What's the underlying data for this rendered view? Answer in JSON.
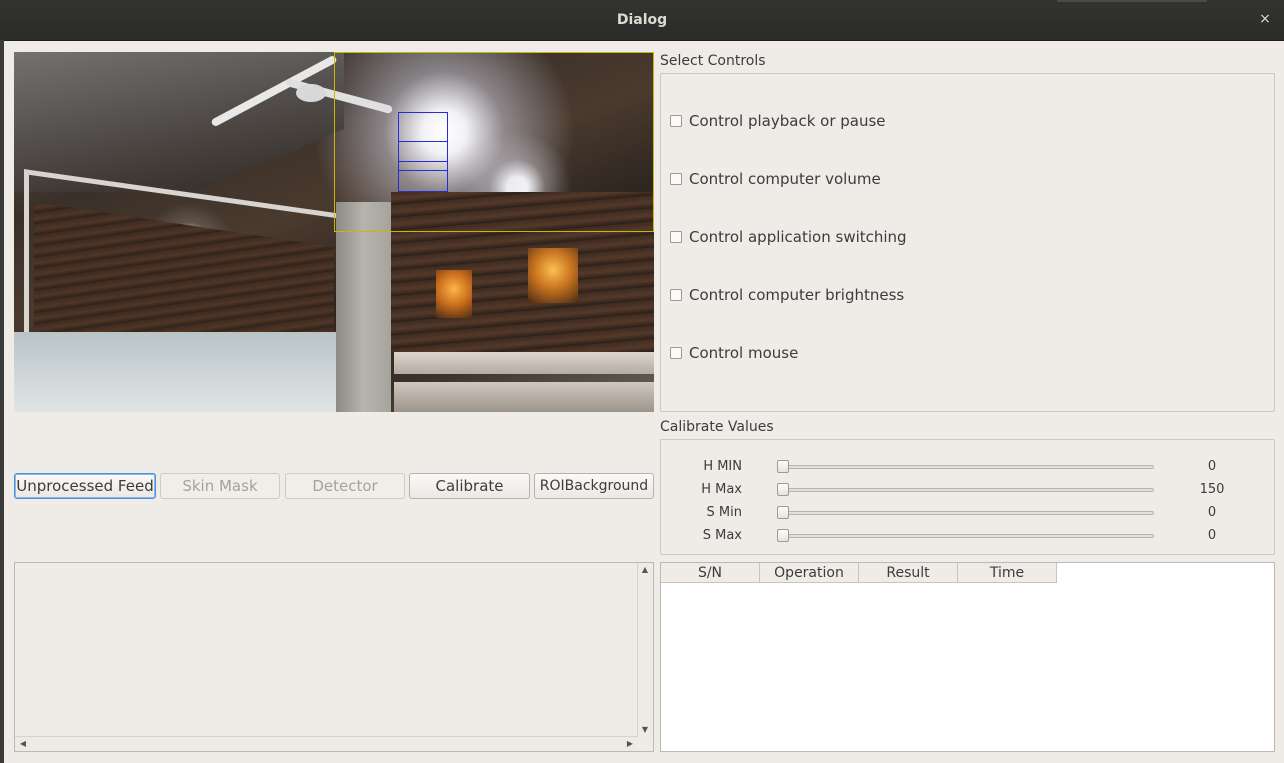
{
  "window": {
    "title": "Dialog",
    "close_glyph": "×"
  },
  "buttons": {
    "unprocessed_feed": "Unprocessed Feed",
    "skin_mask": "Skin Mask",
    "detector": "Detector",
    "calibrate": "Calibrate",
    "roi_background": "ROIBackground"
  },
  "select_controls": {
    "title": "Select Controls",
    "items": [
      {
        "label": "Control playback or pause",
        "checked": false
      },
      {
        "label": "Control computer volume",
        "checked": false
      },
      {
        "label": "Control application switching",
        "checked": false
      },
      {
        "label": "Control computer brightness",
        "checked": false
      },
      {
        "label": "Control mouse",
        "checked": false
      }
    ]
  },
  "calibrate_values": {
    "title": "Calibrate Values",
    "sliders": [
      {
        "label": "H MIN",
        "value": "0",
        "level": 0
      },
      {
        "label": "H Max",
        "value": "150",
        "level": 0
      },
      {
        "label": "S Min",
        "value": "0",
        "level": 0
      },
      {
        "label": "S Max",
        "value": "0",
        "level": 0
      }
    ]
  },
  "table": {
    "columns": [
      "S/N",
      "Operation",
      "Result",
      "Time"
    ],
    "rows": []
  },
  "scroll_arrows": {
    "up": "▲",
    "down": "▼",
    "left": "◀",
    "right": "▶"
  }
}
